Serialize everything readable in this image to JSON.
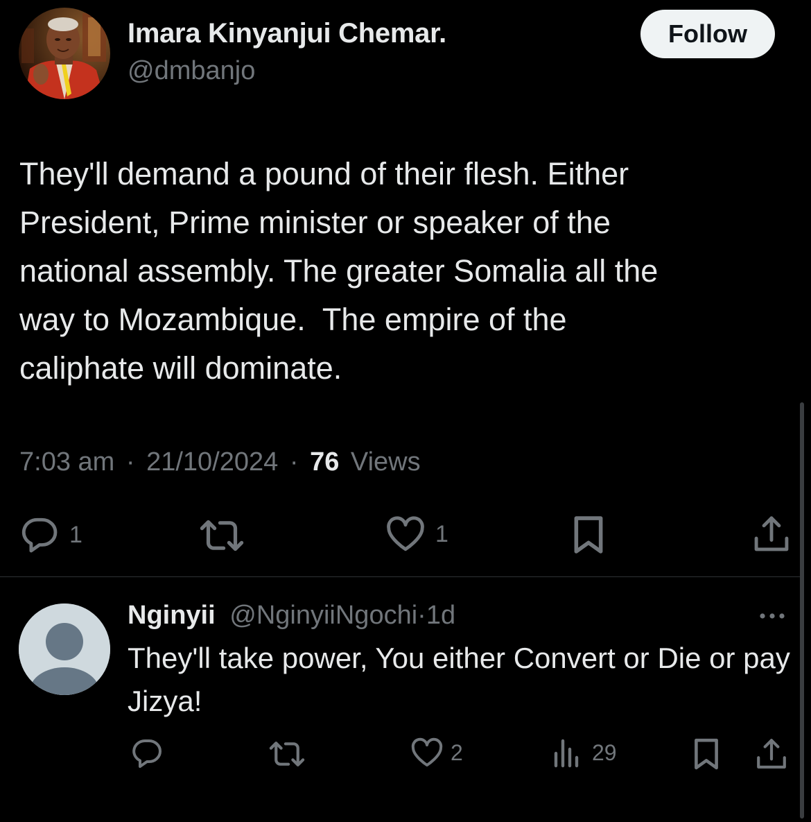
{
  "tweet": {
    "author_name": "Imara Kinyanjui Chemar.",
    "author_handle": "@dmbanjo",
    "follow_label": "Follow",
    "text": "They'll demand a pound of their flesh. Either\nPresident, Prime minister or speaker of the\nnational assembly. The greater Somalia all the\nway to Mozambique.  The empire of the\ncaliphate will dominate.",
    "time": "7:03 am",
    "separator": "·",
    "date": "21/10/2024",
    "views_count": "76",
    "views_label": "Views",
    "actions": {
      "reply_icon": "reply-icon",
      "reply_count": "1",
      "retweet_icon": "retweet-icon",
      "like_icon": "heart-icon",
      "like_count": "1",
      "bookmark_icon": "bookmark-icon",
      "share_icon": "share-icon"
    }
  },
  "reply": {
    "author_name": "Nginyii",
    "author_handle": "@NginyiiNgochi",
    "separator": "·",
    "age": "1d",
    "more_icon": "more-icon",
    "text": "They'll take power, You either Convert or Die or pay Jizya!",
    "actions": {
      "reply_icon": "reply-icon",
      "retweet_icon": "retweet-icon",
      "like_icon": "heart-icon",
      "like_count": "2",
      "views_icon": "views-bars-icon",
      "views_count": "29",
      "bookmark_icon": "bookmark-icon",
      "share_icon": "share-icon"
    }
  },
  "colors": {
    "background": "#000000",
    "primary_text": "#e7e9ea",
    "secondary_text": "#71767b",
    "divider": "#2f3336",
    "follow_button_bg": "#eff3f4",
    "follow_button_text": "#0f1419",
    "default_avatar_bg": "#cfd9de",
    "default_avatar_fg": "#667786"
  }
}
